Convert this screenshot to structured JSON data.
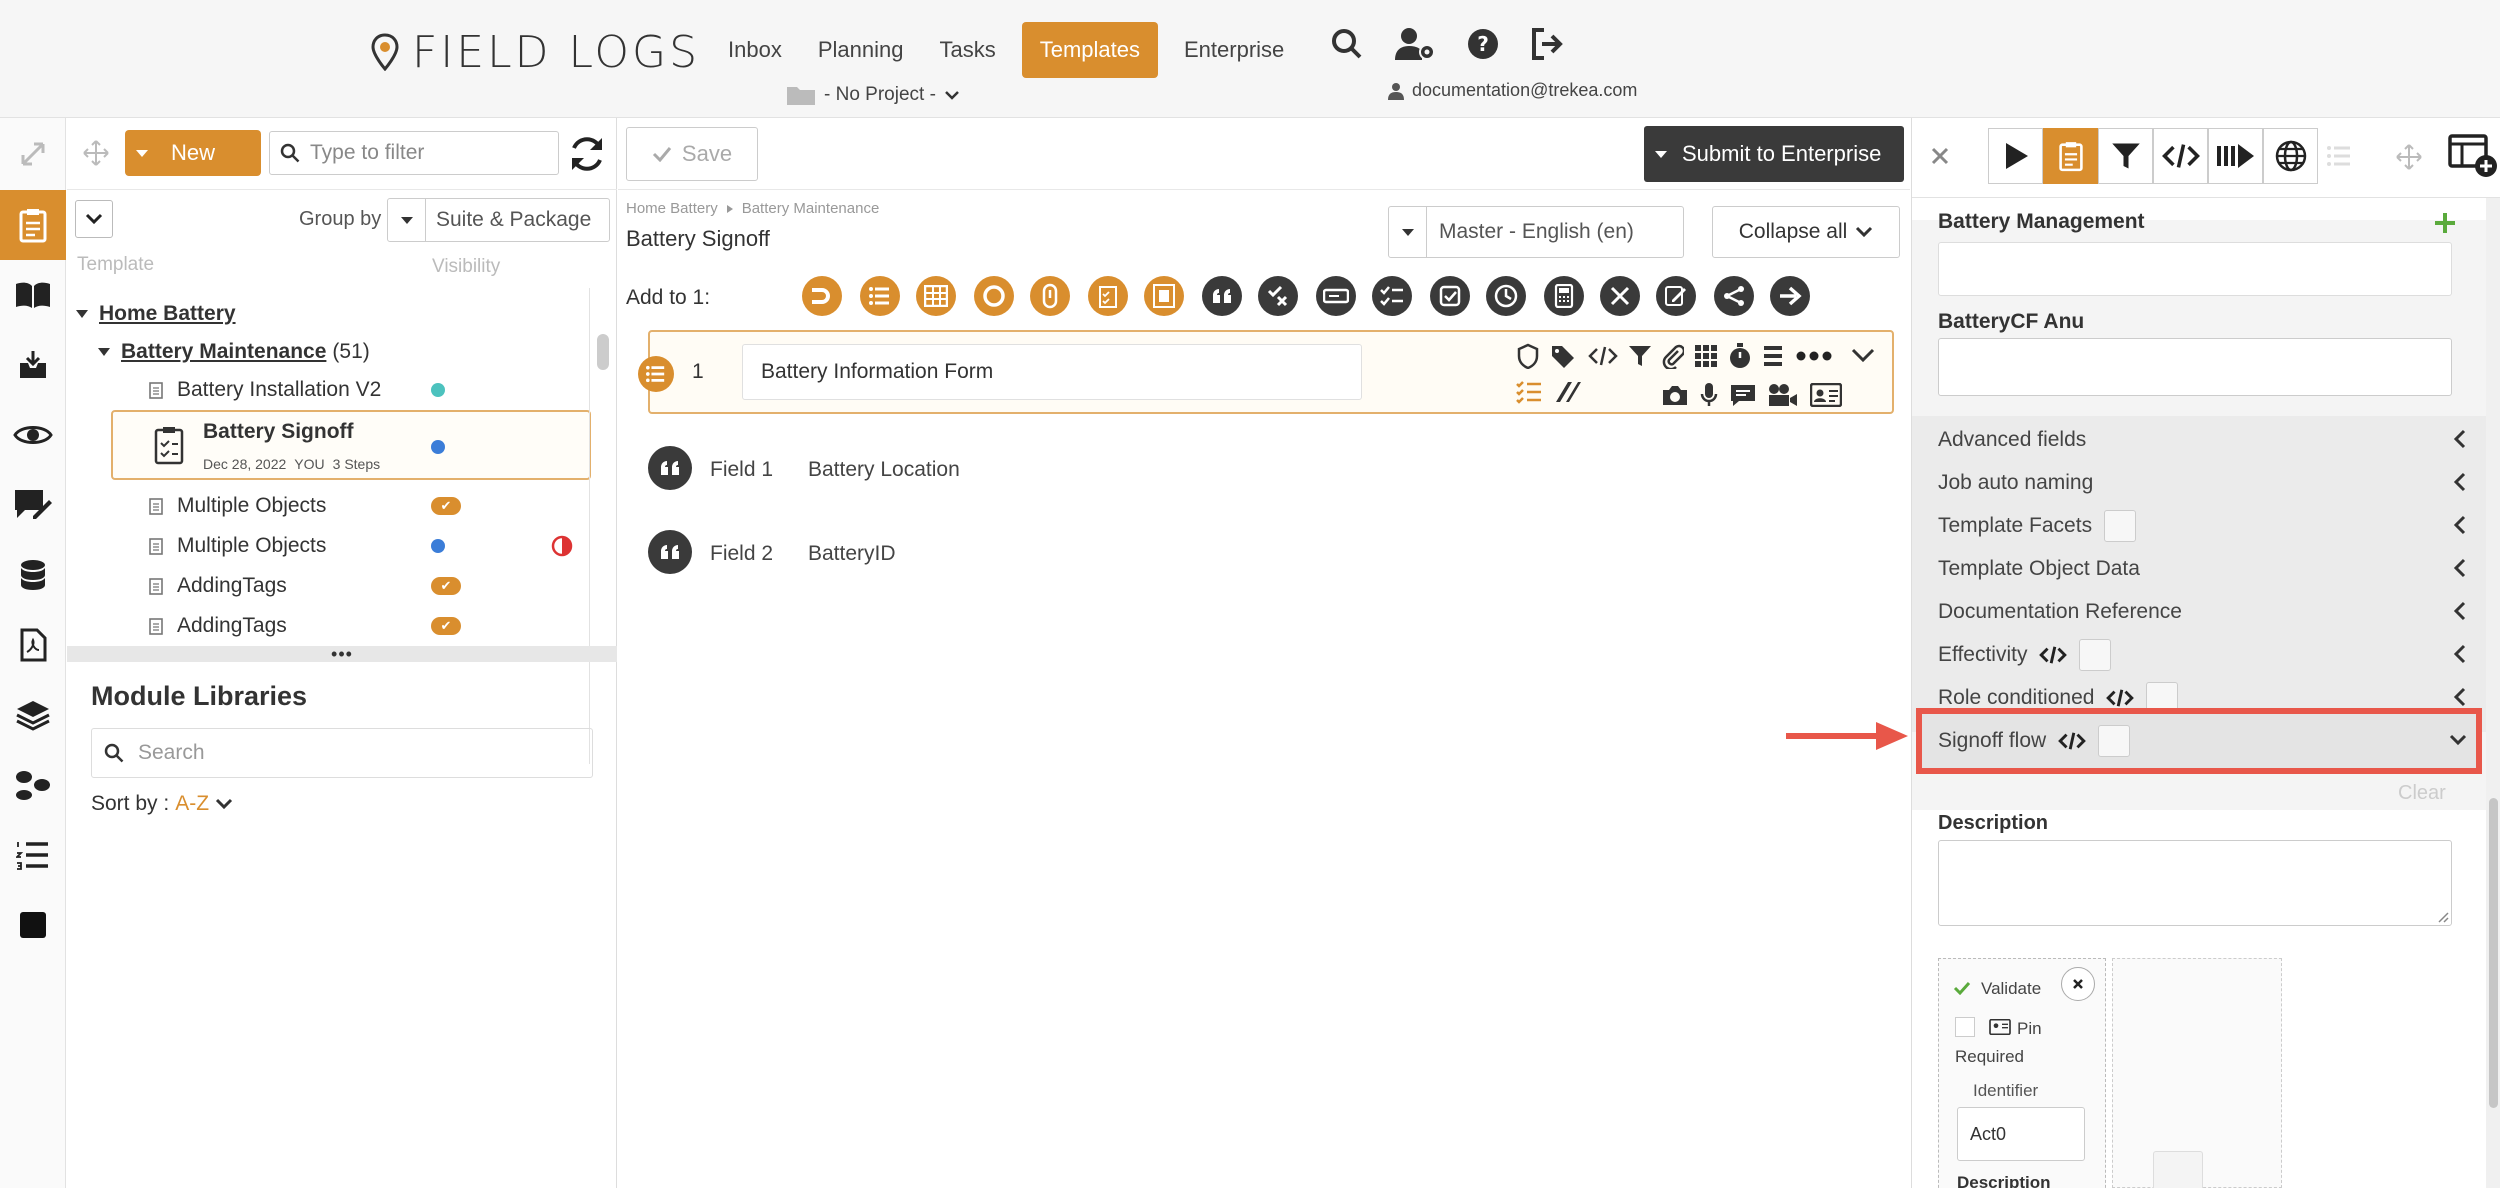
{
  "header": {
    "logo_text": "FIELD LOGS",
    "nav": [
      "Inbox",
      "Planning",
      "Tasks",
      "Templates",
      "Enterprise"
    ],
    "active_nav": "Templates",
    "project_selector": "- No Project -",
    "user_email": "documentation@trekea.com"
  },
  "tree_panel": {
    "new_label": "New",
    "filter_placeholder": "Type to filter",
    "group_by_label": "Group by",
    "group_by_value": "Suite & Package",
    "col_template": "Template",
    "col_visibility": "Visibility",
    "root": "Home Battery",
    "folder": "Battery Maintenance",
    "folder_count": "(51)",
    "items": [
      {
        "label": "Battery Installation V2"
      },
      {
        "label": "Battery Signoff",
        "meta_date": "Dec 28, 2022",
        "meta_user": "YOU",
        "meta_steps": "3 Steps"
      },
      {
        "label": "Multiple Objects"
      },
      {
        "label": "Multiple Objects"
      },
      {
        "label": "AddingTags"
      },
      {
        "label": "AddingTags"
      }
    ],
    "module_libraries_title": "Module Libraries",
    "search_placeholder": "Search",
    "sort_label": "Sort by :",
    "sort_value": "A-Z"
  },
  "center": {
    "save_label": "Save",
    "submit_label": "Submit to Enterprise",
    "breadcrumb": [
      "Home Battery",
      "Battery Maintenance"
    ],
    "title": "Battery Signoff",
    "language_value": "Master - English (en)",
    "collapse_label": "Collapse all",
    "add_to_label": "Add to 1:",
    "step": {
      "number": "1",
      "name": "Battery Information Form"
    },
    "fields": [
      {
        "label": "Field 1",
        "value": "Battery Location"
      },
      {
        "label": "Field 2",
        "value": "BatteryID"
      }
    ]
  },
  "right_panel": {
    "battery_management": "Battery Management",
    "batterycf_anu": "BatteryCF Anu",
    "sections": [
      "Advanced fields",
      "Job auto naming",
      "Template Facets",
      "Template Object Data",
      "Documentation Reference",
      "Effectivity",
      "Role conditioned",
      "Signoff flow"
    ],
    "clear_label": "Clear",
    "description_label": "Description",
    "signoff_card": {
      "validate_label": "Validate",
      "pin_required_label": "Pin Required",
      "identifier_label": "Identifier",
      "identifier_value": "Act0",
      "description_label": "Description"
    }
  },
  "colors": {
    "accent": "#d98e2e",
    "dark": "#3a3a3a",
    "highlight": "#e8574a",
    "green": "#5aaa3c"
  }
}
